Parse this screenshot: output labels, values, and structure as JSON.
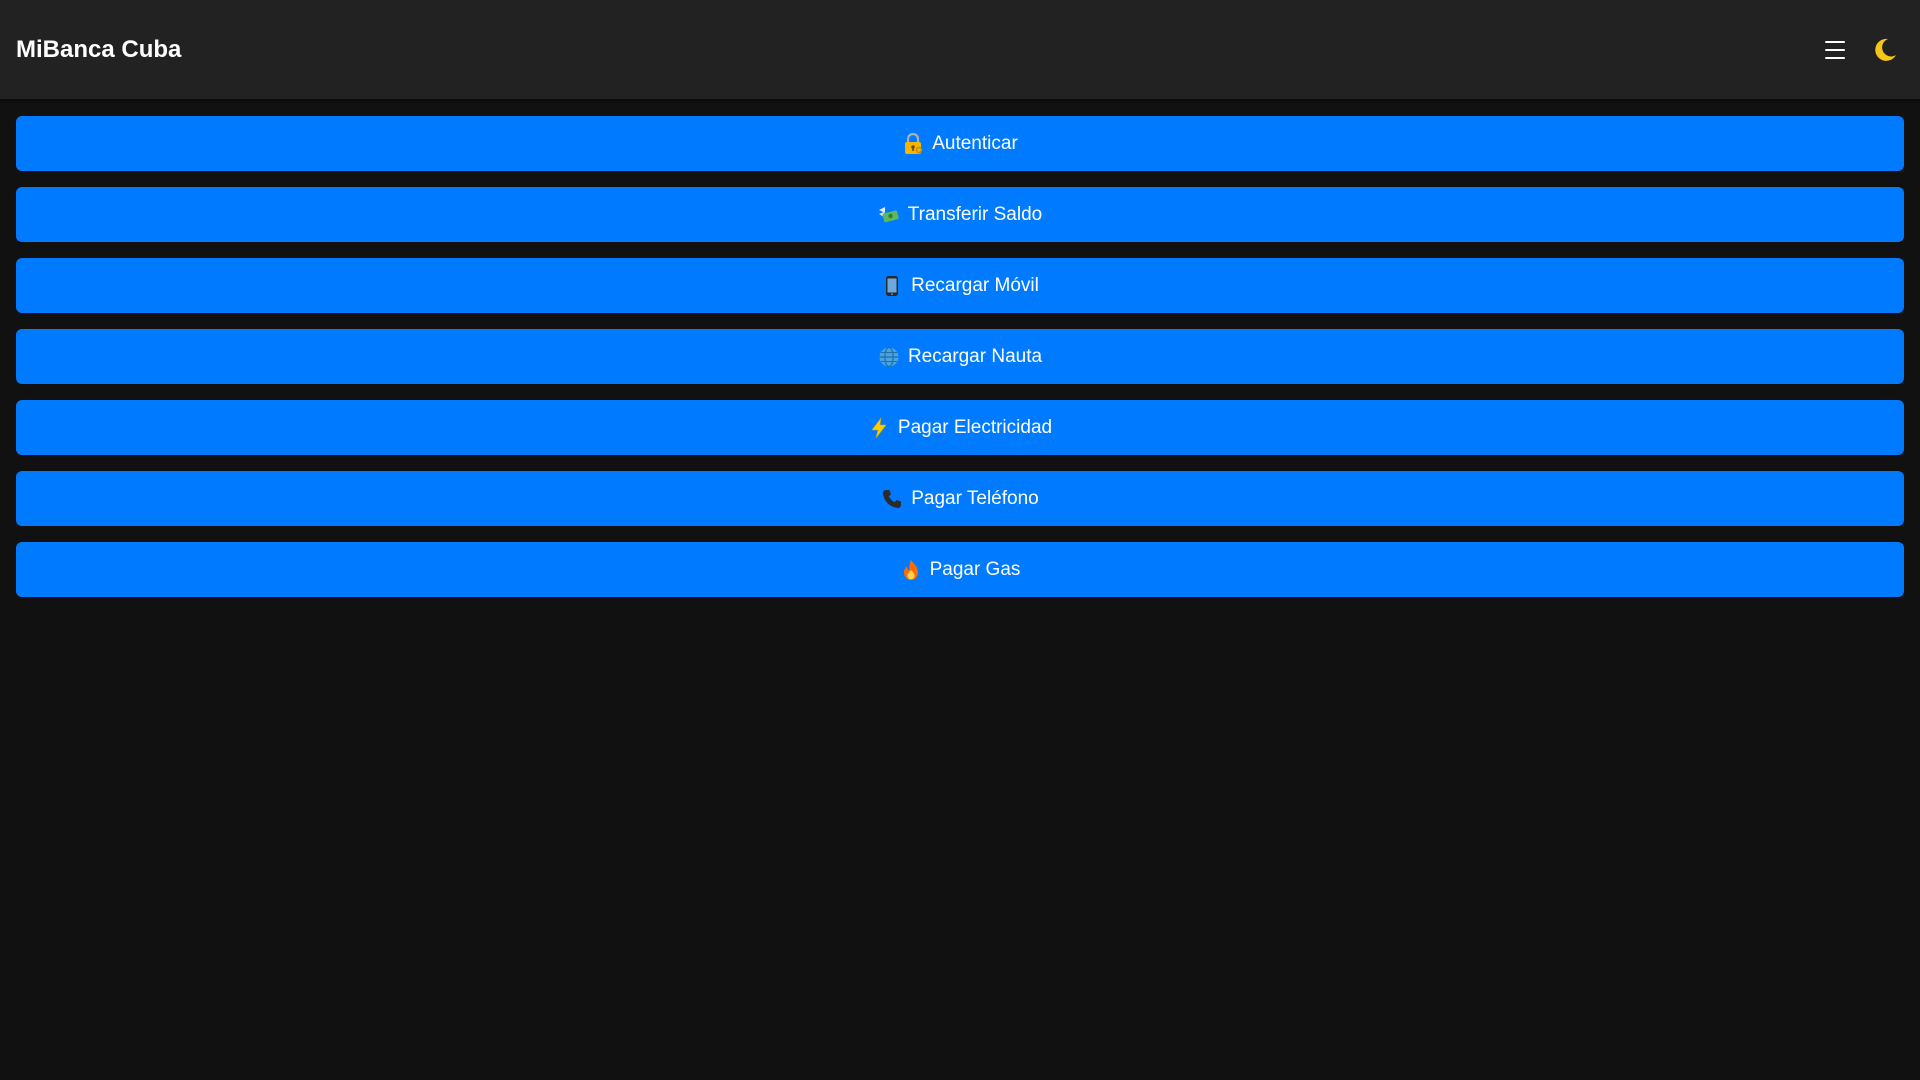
{
  "header": {
    "title": "MiBanca Cuba",
    "menu_icon": "hamburger-menu-icon",
    "theme_icon": "crescent-moon-icon"
  },
  "colors": {
    "background": "#111111",
    "header_bg": "#222222",
    "button_bg": "#007bff",
    "text": "#ffffff",
    "moon": "#f5c518"
  },
  "actions": [
    {
      "label": "Autenticar",
      "icon": "lock-with-key-icon"
    },
    {
      "label": "Transferir Saldo",
      "icon": "money-with-wings-icon"
    },
    {
      "label": "Recargar Móvil",
      "icon": "mobile-phone-icon"
    },
    {
      "label": "Recargar Nauta",
      "icon": "globe-icon"
    },
    {
      "label": "Pagar Electricidad",
      "icon": "lightning-icon"
    },
    {
      "label": "Pagar Teléfono",
      "icon": "telephone-receiver-icon"
    },
    {
      "label": "Pagar Gas",
      "icon": "fire-icon"
    }
  ]
}
